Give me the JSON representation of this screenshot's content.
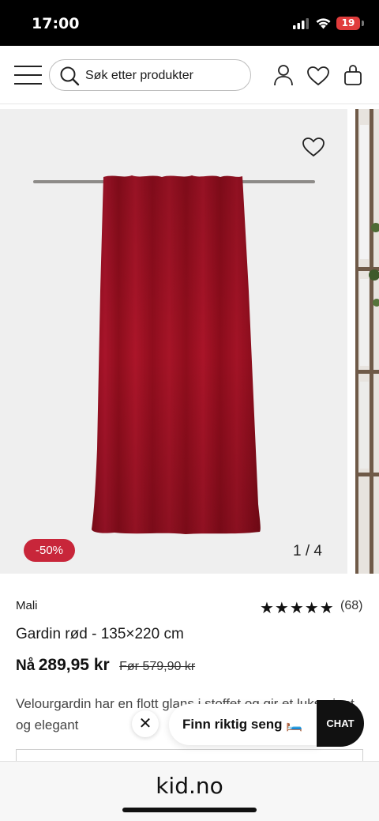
{
  "status_bar": {
    "time": "17:00",
    "battery": "19"
  },
  "header": {
    "search_placeholder": "Søk etter produkter",
    "icons": [
      "menu-icon",
      "search-icon",
      "user-icon",
      "heart-icon",
      "bag-icon"
    ]
  },
  "gallery": {
    "discount_badge": "-50%",
    "counter": "1 / 4",
    "current_slide": 1,
    "total_slides": 4
  },
  "product": {
    "brand": "Mali",
    "rating_stars": "★★★★★",
    "rating_value": 5,
    "rating_count": "(68)",
    "title": "Gardin rød - 135×220 cm",
    "price_now_label": "Nå",
    "price_now": "289,95 kr",
    "price_before": "Før 579,90 kr",
    "description": "Velourgardin har en flott glans i stoffet og gir et luksuriøst og elegant"
  },
  "chat": {
    "prompt": "Finn riktig seng 🛏️",
    "button_label": "CHAT",
    "close_symbol": "✕"
  },
  "browser": {
    "url": "kid.no"
  },
  "colors": {
    "discount_badge": "#c8263a",
    "curtain": "#9e0f1f",
    "chat_button": "#111111",
    "battery": "#e03c3c"
  }
}
